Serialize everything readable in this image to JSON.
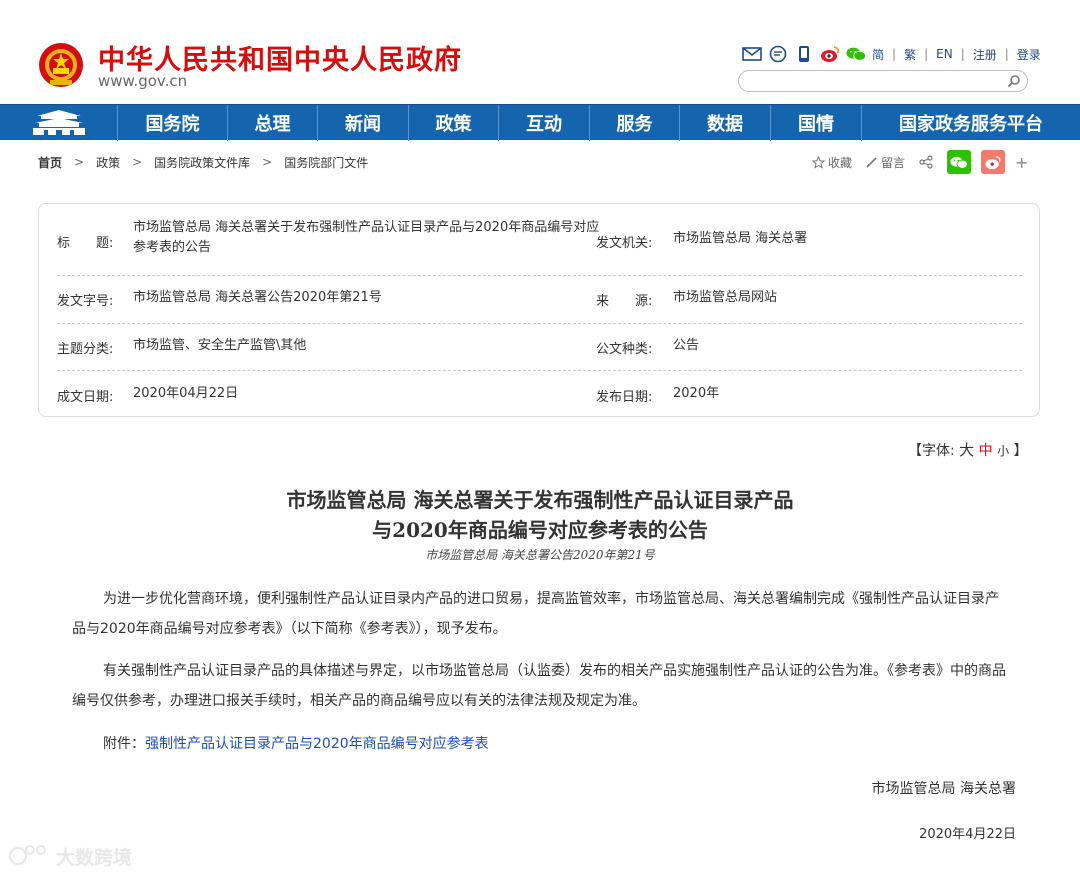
{
  "header": {
    "site_title": "中华人民共和国中央人民政府",
    "site_url": "www.gov.cn",
    "toplinks": [
      "简",
      "繁",
      "EN",
      "注册",
      "登录"
    ],
    "search_placeholder": ""
  },
  "nav": {
    "items": [
      "国务院",
      "总理",
      "新闻",
      "政策",
      "互动",
      "服务",
      "数据",
      "国情",
      "国家政务服务平台"
    ]
  },
  "breadcrumb": [
    "首页",
    "政策",
    "国务院政策文件库",
    "国务院部门文件"
  ],
  "tools": {
    "favorite": "收藏",
    "comment": "留言",
    "more": "+"
  },
  "meta": {
    "title_label": "标　　题:",
    "title_value": "市场监管总局 海关总署关于发布强制性产品认证目录产品与2020年商品编号对应参考表的公告",
    "issuer_label": "发文机关:",
    "issuer_value": "市场监管总局 海关总署",
    "docno_label": "发文字号:",
    "docno_value": "市场监管总局 海关总署公告2020年第21号",
    "source_label": "来　　源:",
    "source_value": "市场监管总局网站",
    "topic_label": "主题分类:",
    "topic_value": "市场监管、安全生产监管\\其他",
    "type_label": "公文种类:",
    "type_value": "公告",
    "written_label": "成文日期:",
    "written_value": "2020年04月22日",
    "published_label": "发布日期:",
    "published_value": "2020年"
  },
  "fontsize": {
    "prefix": "【字体:",
    "large": "大",
    "medium": "中",
    "small": "小",
    "suffix": "】"
  },
  "article": {
    "title_line1": "市场监管总局 海关总署关于发布强制性产品认证目录产品",
    "title_line2": "与2020年商品编号对应参考表的公告",
    "subtitle": "市场监管总局 海关总署公告2020年第21号",
    "para1": "为进一步优化营商环境，便利强制性产品认证目录内产品的进口贸易，提高监管效率，市场监管总局、海关总署编制完成《强制性产品认证目录产品与2020年商品编号对应参考表》（以下简称《参考表》），现予发布。",
    "para2": "有关强制性产品认证目录产品的具体描述与界定，以市场监管总局（认监委）发布的相关产品实施强制性产品认证的公告为准。《参考表》中的商品编号仅供参考，办理进口报关手续时，相关产品的商品编号应以有关的法律法规及规定为准。",
    "attach_label": "附件：",
    "attach_link": "强制性产品认证目录产品与2020年商品编号对应参考表",
    "signature": "市场监管总局 海关总署",
    "date": "2020年4月22日"
  },
  "watermark": "大数跨境",
  "colors": {
    "brand_red": "#d40d0d",
    "nav_blue": "#1465ad",
    "link_blue": "#1a4fb8",
    "wechat_green": "#2dc100",
    "weibo_red": "#e6162d"
  }
}
